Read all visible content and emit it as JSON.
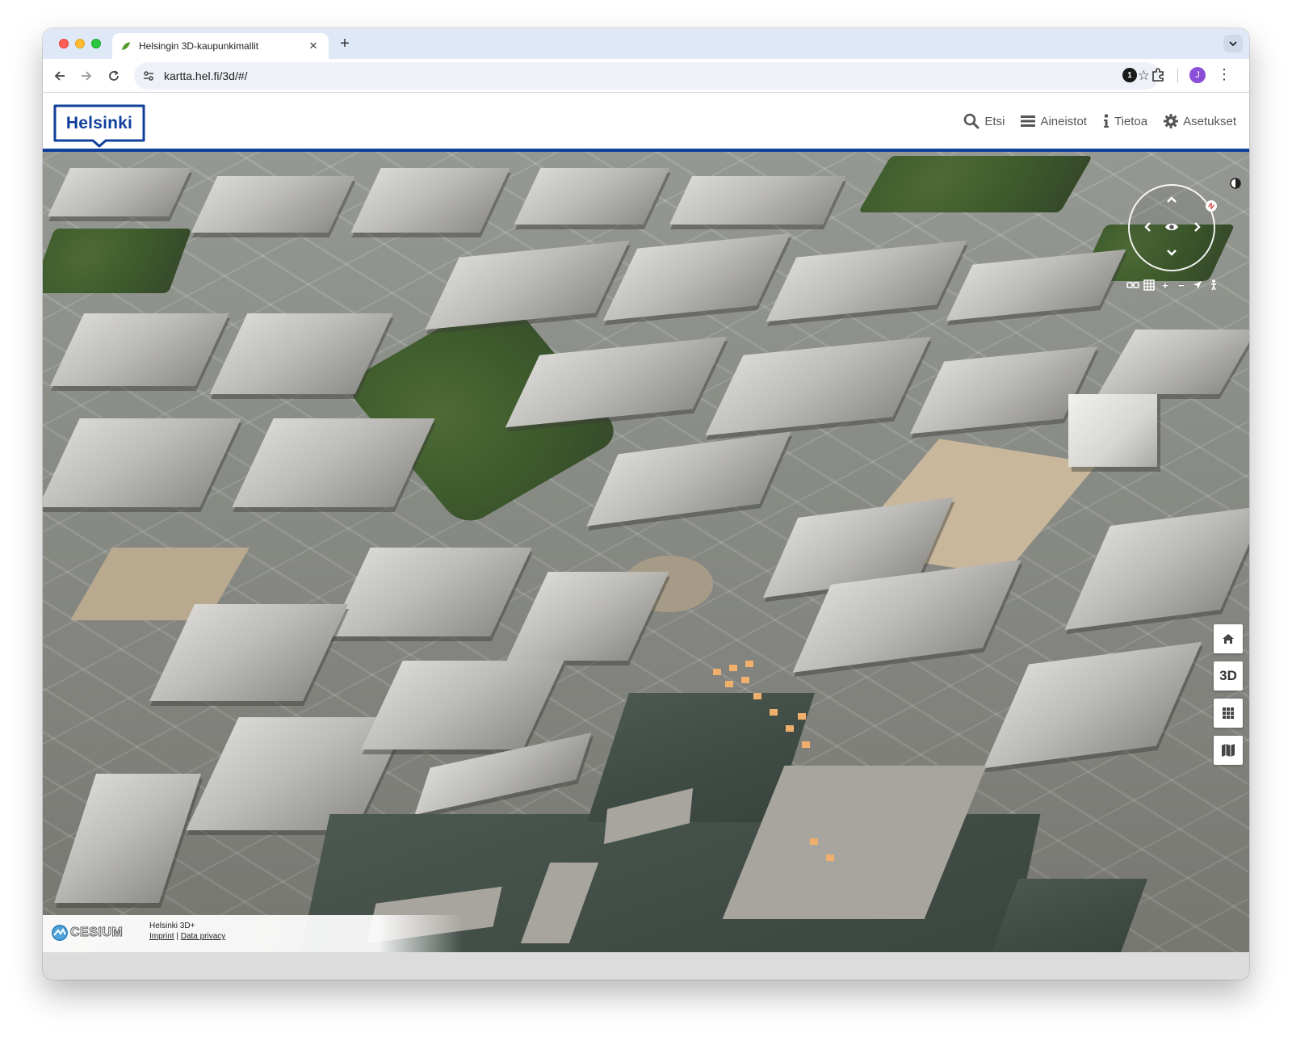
{
  "browser": {
    "tab_title": "Helsingin 3D-kaupunkimallit",
    "tab_close": "✕",
    "new_tab": "+",
    "url": "kartta.hel.fi/3d/#/",
    "extension_badge": "1",
    "avatar_initial": "J"
  },
  "site": {
    "logo_text": "Helsinki",
    "nav": [
      {
        "label": "Etsi",
        "icon": "search-icon"
      },
      {
        "label": "Aineistot",
        "icon": "menu-icon"
      },
      {
        "label": "Tietoa",
        "icon": "info-icon"
      },
      {
        "label": "Asetukset",
        "icon": "gear-icon"
      }
    ],
    "brand_color": "#0f3f9a"
  },
  "map": {
    "north_label": "N",
    "side_tools": {
      "home": "home-icon",
      "mode_3d": "3D",
      "grid": "grid-icon",
      "map": "map-icon"
    },
    "credits": {
      "logo_word": "CESIUM",
      "dataset": "Helsinki 3D+",
      "imprint": "Imprint",
      "separator": " | ",
      "privacy": "Data privacy"
    }
  }
}
